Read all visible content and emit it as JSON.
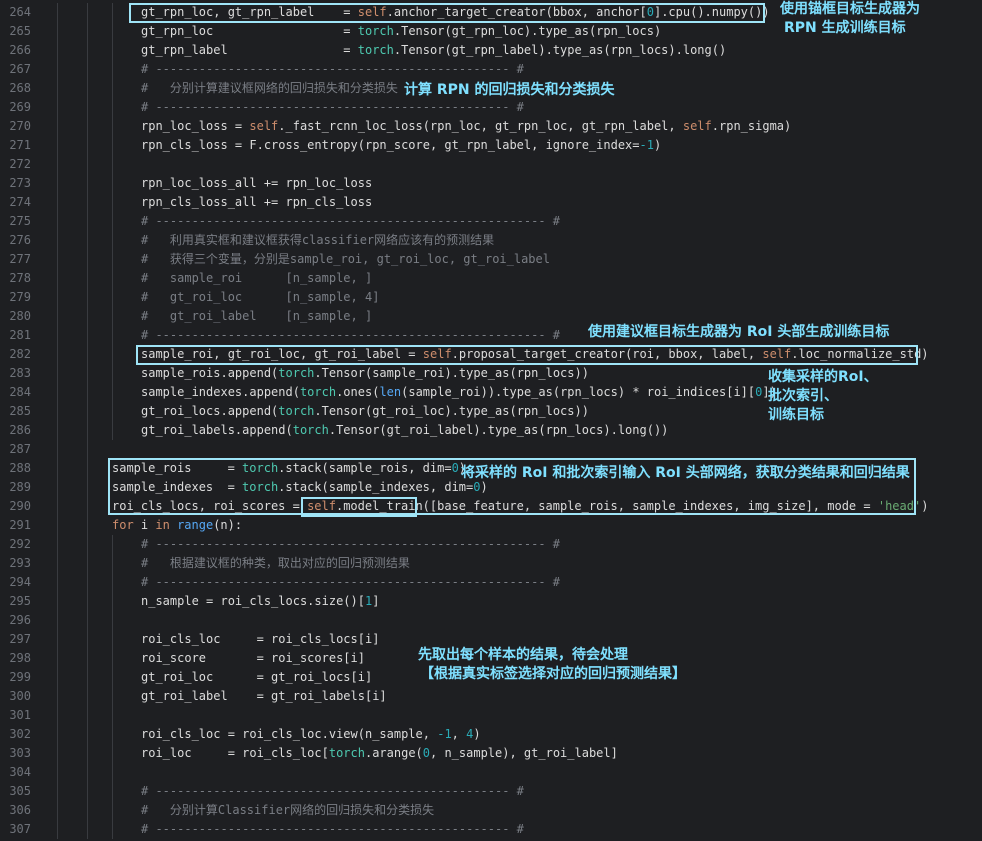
{
  "editor": {
    "lines": [
      {
        "n": "264",
        "indent": 2,
        "html": "gt_rpn_loc, gt_rpn_label    = <span class='kw'>self</span>.anchor_target_creator(bbox, anchor[<span class='num'>0</span>].cpu().numpy())"
      },
      {
        "n": "265",
        "indent": 2,
        "html": "gt_rpn_loc                  = <span class='cls'>torch</span>.Tensor(gt_rpn_loc).type_as(rpn_locs)"
      },
      {
        "n": "266",
        "indent": 2,
        "html": "gt_rpn_label                = <span class='cls'>torch</span>.Tensor(gt_rpn_label).type_as(rpn_locs).long()"
      },
      {
        "n": "267",
        "indent": 2,
        "html": "<span class='cmt'># ------------------------------------------------- #</span>"
      },
      {
        "n": "268",
        "indent": 2,
        "html": "<span class='cmt'>#   分别计算建议框网络的回归损失和分类损失</span>"
      },
      {
        "n": "269",
        "indent": 2,
        "html": "<span class='cmt'># ------------------------------------------------- #</span>"
      },
      {
        "n": "270",
        "indent": 2,
        "html": "rpn_loc_loss = <span class='kw'>self</span>._fast_rcnn_loc_loss(rpn_loc, gt_rpn_loc, gt_rpn_label, <span class='kw'>self</span>.rpn_sigma)"
      },
      {
        "n": "271",
        "indent": 2,
        "html": "rpn_cls_loss = F.cross_entropy(rpn_score, gt_rpn_label, ignore_index=<span class='num'>-1</span>)"
      },
      {
        "n": "272",
        "indent": 2,
        "html": ""
      },
      {
        "n": "273",
        "indent": 2,
        "html": "rpn_loc_loss_all += rpn_loc_loss"
      },
      {
        "n": "274",
        "indent": 2,
        "html": "rpn_cls_loss_all += rpn_cls_loss"
      },
      {
        "n": "275",
        "indent": 2,
        "html": "<span class='cmt'># ------------------------------------------------------ #</span>"
      },
      {
        "n": "276",
        "indent": 2,
        "html": "<span class='cmt'>#   利用真实框和建议框获得classifier网络应该有的预测结果</span>"
      },
      {
        "n": "277",
        "indent": 2,
        "html": "<span class='cmt'>#   获得三个变量，分别是sample_roi, gt_roi_loc, gt_roi_label</span>"
      },
      {
        "n": "278",
        "indent": 2,
        "html": "<span class='cmt'>#   sample_roi      [n_sample, ]</span>"
      },
      {
        "n": "279",
        "indent": 2,
        "html": "<span class='cmt'>#   gt_roi_loc      [n_sample, 4]</span>"
      },
      {
        "n": "280",
        "indent": 2,
        "html": "<span class='cmt'>#   gt_roi_label    [n_sample, ]</span>"
      },
      {
        "n": "281",
        "indent": 2,
        "html": "<span class='cmt'># ------------------------------------------------------ #</span>"
      },
      {
        "n": "282",
        "indent": 2,
        "html": "sample_roi, gt_roi_loc, gt_roi_label = <span class='kw'>self</span>.proposal_target_creator(roi, bbox, label, <span class='kw'>self</span>.loc_normalize_std)"
      },
      {
        "n": "283",
        "indent": 2,
        "html": "sample_rois.append(<span class='cls'>torch</span>.Tensor(sample_roi).type_as(rpn_locs))"
      },
      {
        "n": "284",
        "indent": 2,
        "html": "sample_indexes.append(<span class='cls'>torch</span>.ones(<span class='fn'>len</span>(sample_roi)).type_as(rpn_locs) * roi_indices[i][<span class='num'>0</span>])"
      },
      {
        "n": "285",
        "indent": 2,
        "html": "gt_roi_locs.append(<span class='cls'>torch</span>.Tensor(gt_roi_loc).type_as(rpn_locs))"
      },
      {
        "n": "286",
        "indent": 2,
        "html": "gt_roi_labels.append(<span class='cls'>torch</span>.Tensor(gt_roi_label).type_as(rpn_locs).long())"
      },
      {
        "n": "287",
        "indent": 1,
        "html": ""
      },
      {
        "n": "288",
        "indent": 1,
        "html": "sample_rois     = <span class='cls'>torch</span>.stack(sample_rois, dim=<span class='num'>0</span>)"
      },
      {
        "n": "289",
        "indent": 1,
        "html": "sample_indexes  = <span class='cls'>torch</span>.stack(sample_indexes, dim=<span class='num'>0</span>)"
      },
      {
        "n": "290",
        "indent": 1,
        "html": "roi_cls_locs, roi_scores = <span class='kw'>self</span>.model_train([base_feature, sample_rois, sample_indexes, img_size], mode = <span class='str'>'head'</span>)"
      },
      {
        "n": "291",
        "indent": 1,
        "html": "<span class='kw'>for</span> i <span class='kw'>in</span> <span class='fn'>range</span>(n):"
      },
      {
        "n": "292",
        "indent": 2,
        "html": "<span class='cmt'># ------------------------------------------------------ #</span>"
      },
      {
        "n": "293",
        "indent": 2,
        "html": "<span class='cmt'>#   根据建议框的种类，取出对应的回归预测结果</span>"
      },
      {
        "n": "294",
        "indent": 2,
        "html": "<span class='cmt'># ------------------------------------------------------ #</span>"
      },
      {
        "n": "295",
        "indent": 2,
        "html": "n_sample = roi_cls_locs.size()[<span class='num'>1</span>]"
      },
      {
        "n": "296",
        "indent": 2,
        "html": ""
      },
      {
        "n": "297",
        "indent": 2,
        "html": "roi_cls_loc     = roi_cls_locs[i]"
      },
      {
        "n": "298",
        "indent": 2,
        "html": "roi_score       = roi_scores[i]"
      },
      {
        "n": "299",
        "indent": 2,
        "html": "gt_roi_loc      = gt_roi_locs[i]"
      },
      {
        "n": "300",
        "indent": 2,
        "html": "gt_roi_label    = gt_roi_labels[i]"
      },
      {
        "n": "301",
        "indent": 2,
        "html": ""
      },
      {
        "n": "302",
        "indent": 2,
        "html": "roi_cls_loc = roi_cls_loc.view(n_sample, <span class='num'>-1</span>, <span class='num'>4</span>)"
      },
      {
        "n": "303",
        "indent": 2,
        "html": "roi_loc     = roi_cls_loc[<span class='cls'>torch</span>.arange(<span class='num'>0</span>, n_sample), gt_roi_label]"
      },
      {
        "n": "304",
        "indent": 2,
        "html": ""
      },
      {
        "n": "305",
        "indent": 2,
        "html": "<span class='cmt'># ------------------------------------------------- #</span>"
      },
      {
        "n": "306",
        "indent": 2,
        "html": "<span class='cmt'>#   分别计算Classifier网络的回归损失和分类损失</span>"
      },
      {
        "n": "307",
        "indent": 2,
        "html": "<span class='cmt'># ------------------------------------------------- #</span>"
      }
    ]
  },
  "annotations": {
    "anchor_target_1": "使用锚框目标生成器为",
    "anchor_target_2": "RPN 生成训练目标",
    "rpn_loss": "计算 RPN 的回归损失和分类损失",
    "proposal_target": "使用建议框目标生成器为 RoI 头部生成训练目标",
    "collect_1": "收集采样的RoI、",
    "collect_2": "批次索引、",
    "collect_3": "训练目标",
    "head_input": "将采样的 RoI 和批次索引输入 RoI 头部网络，获取分类结果和回归结果",
    "per_sample_1": "先取出每个样本的结果，待会处理",
    "per_sample_2": "【根据真实标签选择对应的回归预测结果】"
  },
  "colors": {
    "background": "#1e1f22",
    "annotation": "#7fe0ff",
    "highlight_box": "#9fe4f7"
  }
}
